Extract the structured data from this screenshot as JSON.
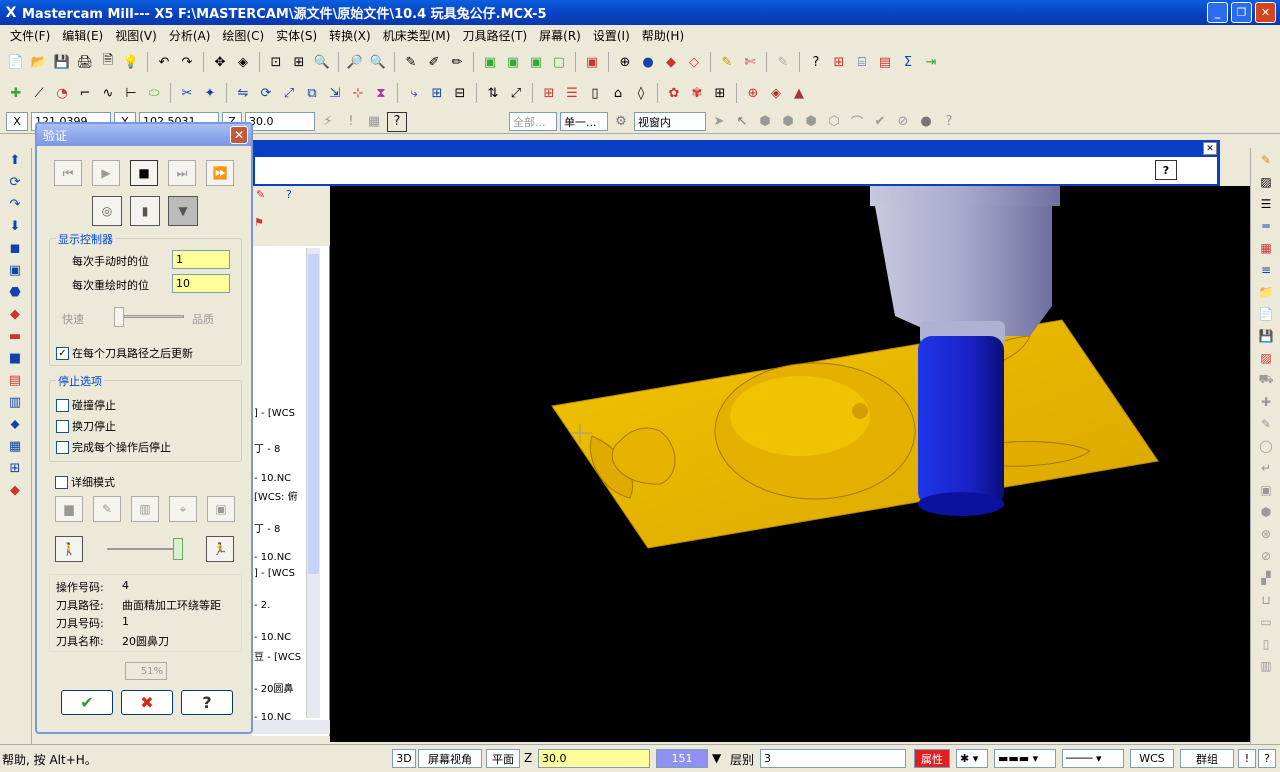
{
  "window": {
    "title": "Mastercam Mill--- X5  F:\\MASTERCAM\\源文件\\原始文件\\10.4 玩具兔公仔.MCX-5"
  },
  "menu": [
    "文件(F)",
    "编辑(E)",
    "视图(V)",
    "分析(A)",
    "绘图(C)",
    "实体(S)",
    "转换(X)",
    "机床类型(M)",
    "刀具路径(T)",
    "屏幕(R)",
    "设置(I)",
    "帮助(H)"
  ],
  "coord_bar": {
    "x_label": "X",
    "x_value": "121.0399",
    "y_label": "Y",
    "y_value": "102.5031",
    "z_label": "Z",
    "z_value": "30.0",
    "all_label": "全部...",
    "single_label": "单一...",
    "view_label": "视窗内"
  },
  "dialog": {
    "title": "验证",
    "display_group": "显示控制器",
    "manual_step_label": "每次手动时的位",
    "manual_step_value": "1",
    "redraw_step_label": "每次重绘时的位",
    "redraw_step_value": "10",
    "fast_label": "快速",
    "quality_label": "品质",
    "update_after_each": "在每个刀具路径之后更新",
    "stop_group": "停止选项",
    "stop_collision": "碰撞停止",
    "stop_toolchange": "换刀停止",
    "stop_each_op": "完成每个操作后停止",
    "detail_mode": "详细模式",
    "info": [
      {
        "k": "操作号码:",
        "v": "4"
      },
      {
        "k": "刀具路径:",
        "v": "曲面精加工环绕等距"
      },
      {
        "k": "刀具号码:",
        "v": "1"
      },
      {
        "k": "刀具名称:",
        "v": "20圆鼻刀"
      }
    ],
    "progress_text": "51%",
    "progress": 51
  },
  "ops_panel": {
    "lines": [
      "] - [WCS",
      "丁 -    8",
      "- 10.NC",
      "[WCS: 俯",
      "丁 -    8",
      "- 10.NC",
      "] - [WCS",
      "-    2.",
      "- 10.NC",
      "豆 - [WCS",
      "- 20圆鼻",
      "- 10.NC"
    ]
  },
  "status": {
    "help": "帮助, 按 Alt+H。",
    "mode3d": "3D",
    "screen_view": "屏幕视角",
    "plane": "平面",
    "z_label": "Z",
    "z_value": "30.0",
    "color_value": "151",
    "layer_label": "层别",
    "layer_value": "3",
    "attr_label": "属性",
    "wcs": "WCS",
    "group": "群组",
    "excl": "!",
    "help_q": "?"
  },
  "colors": {
    "model": "#e8b400",
    "tool": "#1b2fd8",
    "holder": "#a5a5c0",
    "viewport": "#000000",
    "title": "#0a47d8"
  }
}
